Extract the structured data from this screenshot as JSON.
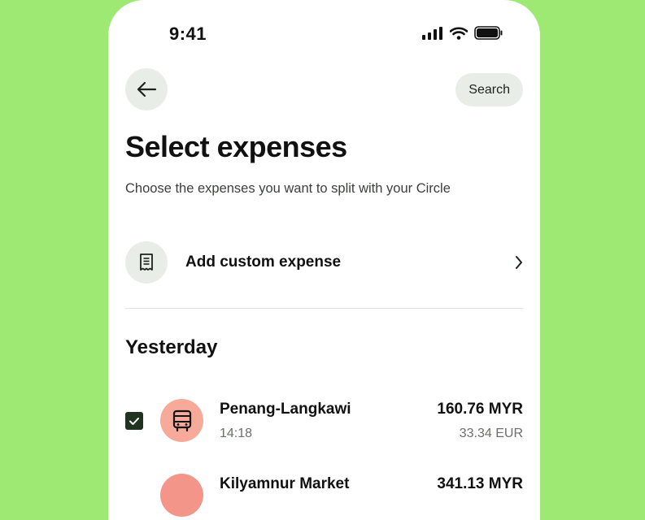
{
  "status_bar": {
    "time": "9:41"
  },
  "header": {
    "search_label": "Search"
  },
  "page": {
    "title": "Select expenses",
    "subtitle": "Choose the expenses you want to split with your Circle"
  },
  "custom_expense": {
    "label": "Add custom expense"
  },
  "section": {
    "title": "Yesterday"
  },
  "expenses": [
    {
      "name": "Penang-Langkawi",
      "time": "14:18",
      "amount": "160.76 MYR",
      "converted": "33.34 EUR",
      "checked": true,
      "icon": "bus-icon"
    },
    {
      "name": "Kilyamnur Market",
      "amount": "341.13 MYR",
      "icon": "shop-icon"
    }
  ],
  "colors": {
    "background": "#9ee874",
    "accent_dark": "#1f3320",
    "avatar": "#f7a99a",
    "chip": "#e9ede8"
  }
}
